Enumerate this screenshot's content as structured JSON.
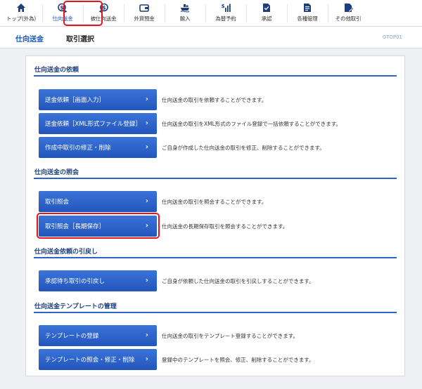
{
  "nav": {
    "items": [
      {
        "label": "トップ(外為)",
        "icon": "home-icon"
      },
      {
        "label": "仕向送金",
        "icon": "remittance-icon"
      },
      {
        "label": "被仕向送金",
        "icon": "incoming-remittance-icon"
      },
      {
        "label": "外貨預金",
        "icon": "wallet-icon"
      },
      {
        "label": "輸入",
        "icon": "ship-icon"
      },
      {
        "label": "為替予約",
        "icon": "chart-icon"
      },
      {
        "label": "承認",
        "icon": "approval-icon"
      },
      {
        "label": "各種管理",
        "icon": "management-icon"
      },
      {
        "label": "その他取引",
        "icon": "document-icon"
      }
    ],
    "active_index": 1
  },
  "titlebar": {
    "main": "仕向送金",
    "sub": "取引選択",
    "code": "GTOP01"
  },
  "sections": [
    {
      "heading": "仕向送金の依頼",
      "buttons": [
        {
          "label": "送金依頼［画面入力］",
          "desc": "仕向送金の取引を依頼することができます。"
        },
        {
          "label": "送金依頼［XML形式ファイル登録］",
          "desc": "仕向送金の取引をXML形式のファイル登録で一括依頼することができます。"
        },
        {
          "label": "作成中取引の修正・削除",
          "desc": "ご自身が作成した仕向送金の取引を修正、削除することができます。"
        }
      ]
    },
    {
      "heading": "仕向送金の照会",
      "buttons": [
        {
          "label": "取引照会",
          "desc": "仕向送金の取引を照会することができます。"
        },
        {
          "label": "取引照会［長期保存］",
          "desc": "仕向送金の長期保存取引を照会することができます。"
        }
      ]
    },
    {
      "heading": "仕向送金依頼の引戻し",
      "buttons": [
        {
          "label": "承認待ち取引の引戻し",
          "desc": "ご自身が依頼した仕向送金の取引を引戻しすることができます。"
        }
      ]
    },
    {
      "heading": "仕向送金テンプレートの管理",
      "buttons": [
        {
          "label": "テンプレートの登録",
          "desc": "仕向送金の取引をテンプレート登録することができます。"
        },
        {
          "label": "テンプレートの照会・修正・削除",
          "desc": "登録中のテンプレートを照会、修正、削除することができます。"
        }
      ]
    }
  ],
  "chevron": "›",
  "colors": {
    "accent": "#2356bc",
    "highlight": "#e4141f",
    "heading": "#1e3f7a"
  }
}
